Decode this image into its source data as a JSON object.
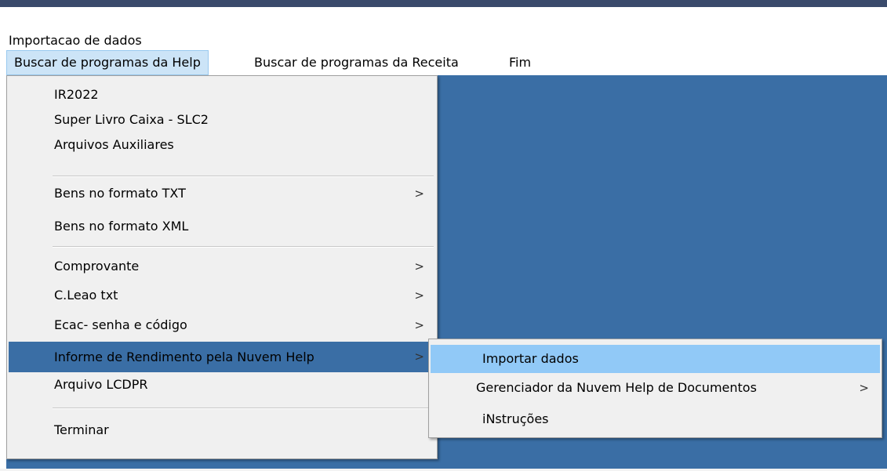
{
  "window": {
    "title": "Importacao de dados"
  },
  "menubar": {
    "items": [
      {
        "label": "Buscar de programas da Help"
      },
      {
        "label": "Buscar de programas da Receita"
      },
      {
        "label": "Fim"
      }
    ]
  },
  "main_menu": {
    "items": [
      {
        "label": "IR2022"
      },
      {
        "label": "Super Livro Caixa - SLC2"
      },
      {
        "label": "Arquivos Auxiliares"
      },
      {
        "label": "Bens no formato TXT",
        "submenu": true
      },
      {
        "label": "Bens no formato XML"
      },
      {
        "label": "Comprovante",
        "submenu": true
      },
      {
        "label": "C.Leao txt",
        "submenu": true
      },
      {
        "label": "Ecac- senha e código",
        "submenu": true
      },
      {
        "label": "Informe de Rendimento pela Nuvem Help",
        "submenu": true
      },
      {
        "label": "Arquivo LCDPR"
      },
      {
        "label": "Terminar"
      }
    ],
    "chevron": ">"
  },
  "sub_menu": {
    "items": [
      {
        "label": "Importar dados"
      },
      {
        "label": "Gerenciador da Nuvem Help de Documentos",
        "submenu": true
      },
      {
        "label": "iNstruções"
      }
    ],
    "chevron": ">"
  },
  "colors": {
    "desktop": "#3a6ea5",
    "menu_background": "#f0f0f0",
    "submenu_hover": "#91c9f7",
    "menubar_active": "#cce4f7"
  }
}
